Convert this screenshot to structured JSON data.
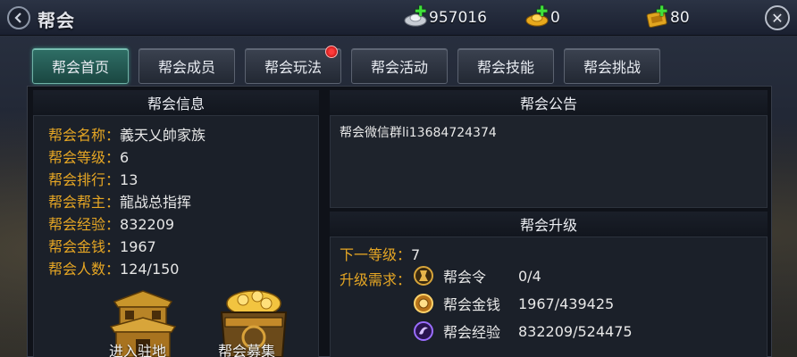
{
  "header": {
    "title": "帮会",
    "back_icon": "back-arrow-icon",
    "close_icon": "close-icon",
    "silver": "957016",
    "gold": "0",
    "vouchers": "80"
  },
  "tabs": [
    {
      "label": "帮会首页",
      "active": true
    },
    {
      "label": "帮会成员",
      "active": false
    },
    {
      "label": "帮会玩法",
      "active": false,
      "badge": true
    },
    {
      "label": "帮会活动",
      "active": false
    },
    {
      "label": "帮会技能",
      "active": false
    },
    {
      "label": "帮会挑战",
      "active": false
    }
  ],
  "info": {
    "heading": "帮会信息",
    "rows": [
      {
        "key": "帮会名称：",
        "value": "義天乂帥家族"
      },
      {
        "key": "帮会等级：",
        "value": "6"
      },
      {
        "key": "帮会排行：",
        "value": "13"
      },
      {
        "key": "帮会帮主：",
        "value": "龍战总指挥"
      },
      {
        "key": "帮会经验：",
        "value": "832209"
      },
      {
        "key": "帮会金钱：",
        "value": "1967"
      },
      {
        "key": "帮会人数：",
        "value": "124/150"
      }
    ],
    "buildings": [
      {
        "label": "进入驻地"
      },
      {
        "label": "帮会募集"
      }
    ]
  },
  "notice": {
    "heading": "帮会公告",
    "text": "帮会微信群li13684724374"
  },
  "upgrade": {
    "heading": "帮会升级",
    "next_level_key": "下一等级：",
    "next_level_value": "7",
    "req_key": "升级需求：",
    "requirements": [
      {
        "name": "帮会令",
        "value": "0/4",
        "icon": "guild-token-icon"
      },
      {
        "name": "帮会金钱",
        "value": "1967/439425",
        "icon": "guild-money-icon"
      },
      {
        "name": "帮会经验",
        "value": "832209/524475",
        "icon": "guild-exp-icon"
      }
    ]
  },
  "colors": {
    "label_gold": "#e6a624",
    "tab_active": "#2f6f66",
    "badge_red": "#ff3b3b"
  }
}
